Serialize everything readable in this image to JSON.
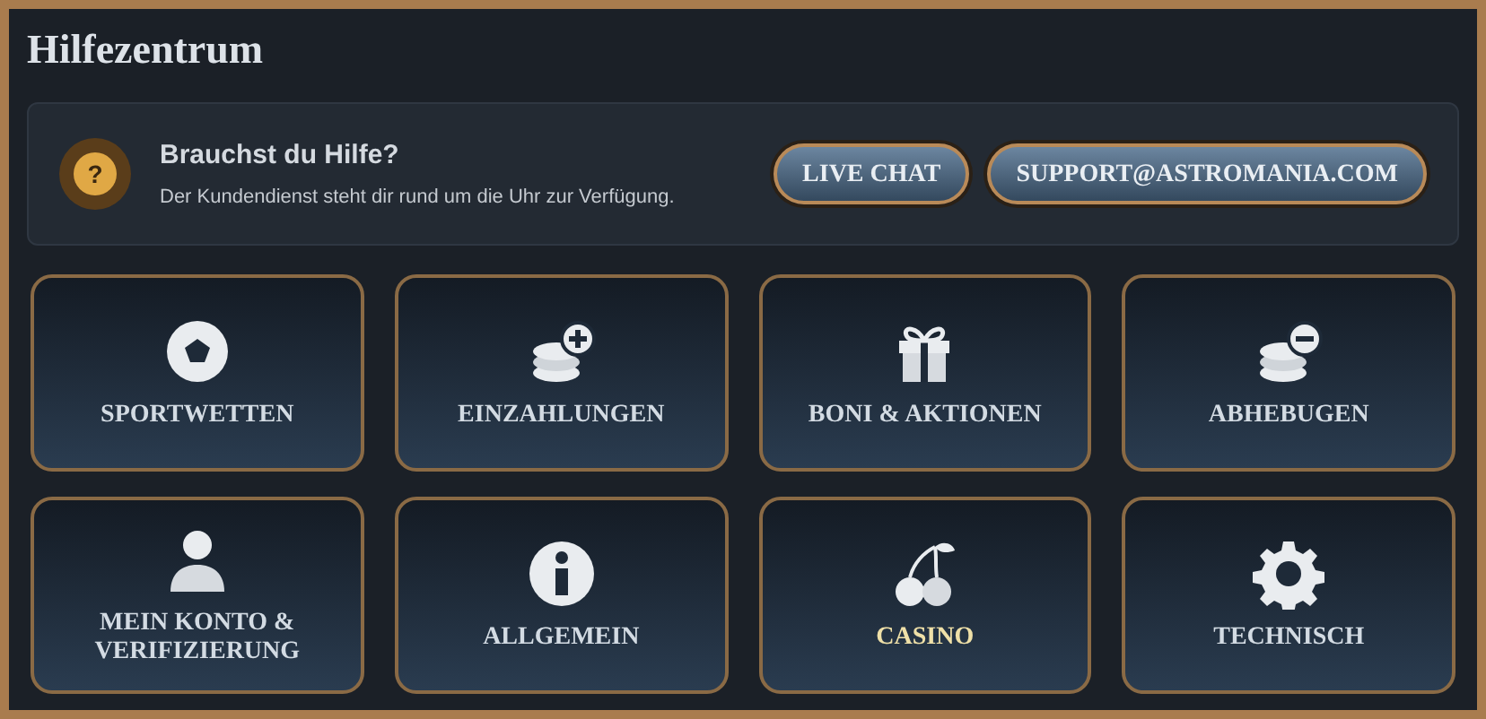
{
  "title": "Hilfezentrum",
  "help": {
    "heading": "Brauchst du Hilfe?",
    "text": "Der Kundendienst steht dir rund um die Uhr zur Verfügung.",
    "icon_glyph": "?",
    "buttons": [
      "LIVE CHAT",
      "SUPPORT@ASTROMANIA.COM"
    ]
  },
  "categories": [
    {
      "label": "SPORTWETTEN",
      "selected": false
    },
    {
      "label": "EINZAHLUNGEN",
      "selected": false
    },
    {
      "label": "BONI & AKTIONEN",
      "selected": false
    },
    {
      "label": "ABHEBUGEN",
      "selected": false
    },
    {
      "label": "MEIN KONTO & VERIFIZIERUNG",
      "selected": false
    },
    {
      "label": "ALLGEMEIN",
      "selected": false
    },
    {
      "label": "CASINO",
      "selected": true
    },
    {
      "label": "TECHNISCH",
      "selected": false
    }
  ]
}
